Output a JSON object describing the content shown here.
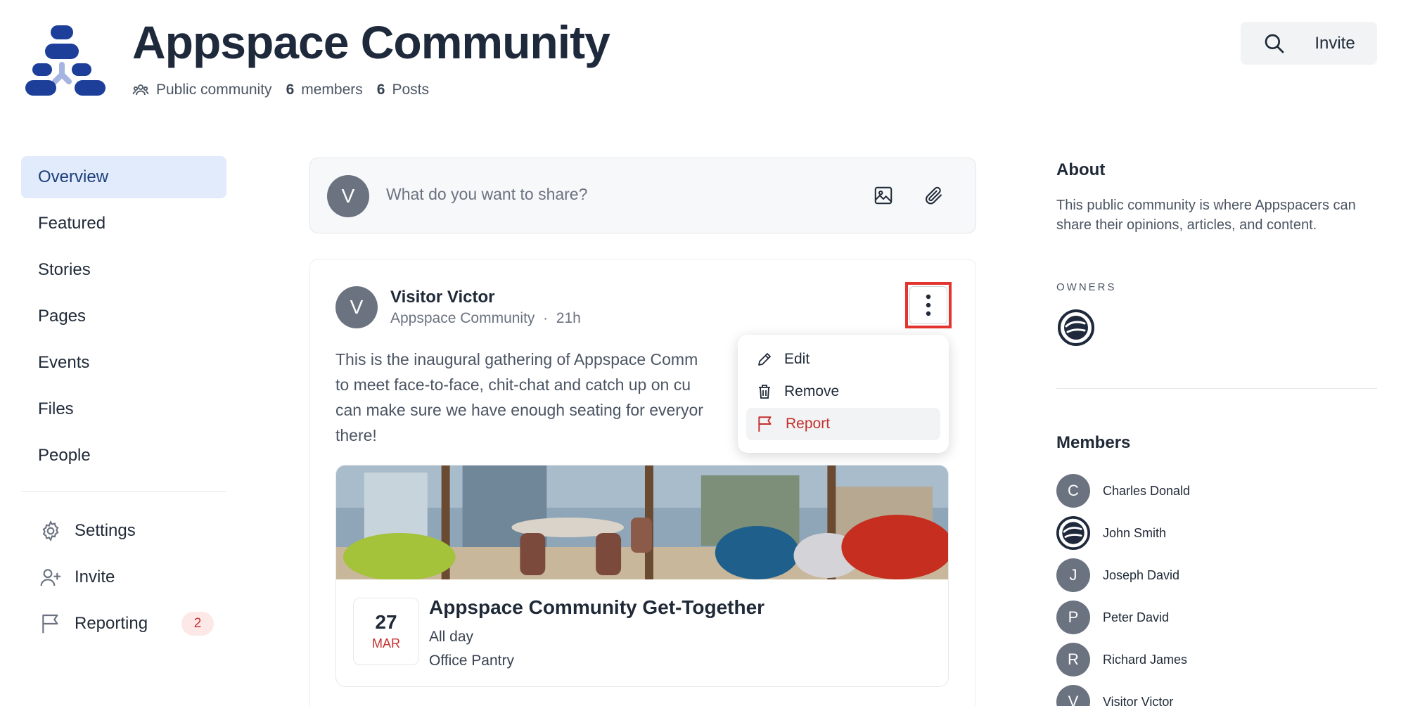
{
  "header": {
    "title": "Appspace Community",
    "community_type": "Public community",
    "members_count": "6",
    "members_label": "members",
    "posts_count": "6",
    "posts_label": "Posts",
    "invite_label": "Invite"
  },
  "nav": {
    "items": [
      {
        "label": "Overview"
      },
      {
        "label": "Featured"
      },
      {
        "label": "Stories"
      },
      {
        "label": "Pages"
      },
      {
        "label": "Events"
      },
      {
        "label": "Files"
      },
      {
        "label": "People"
      }
    ],
    "settings": "Settings",
    "invite": "Invite",
    "reporting": "Reporting",
    "reporting_count": "2"
  },
  "composer": {
    "avatar_letter": "V",
    "placeholder": "What do you want to share?"
  },
  "post": {
    "avatar_letter": "V",
    "author": "Visitor Victor",
    "community": "Appspace Community",
    "time": "21h",
    "body_line1": "This is the inaugural gathering of Appspace Comm",
    "body_line2": "to meet face-to-face, chit-chat and catch up on cu",
    "body_line3": "can make sure we have enough seating for everyor",
    "body_line4": "there!",
    "event": {
      "day": "27",
      "month": "MAR",
      "title": "Appspace Community Get-Together",
      "time": "All day",
      "location": "Office Pantry"
    }
  },
  "menu": {
    "edit": "Edit",
    "remove": "Remove",
    "report": "Report"
  },
  "about": {
    "heading": "About",
    "text": "This public community is where Appspacers can share their opinions, articles, and content.",
    "owners_heading": "OWNERS"
  },
  "members": {
    "heading": "Members",
    "list": [
      {
        "letter": "C",
        "name": "Charles Donald"
      },
      {
        "letter": "",
        "name": "John Smith"
      },
      {
        "letter": "J",
        "name": "Joseph David"
      },
      {
        "letter": "P",
        "name": "Peter David"
      },
      {
        "letter": "R",
        "name": "Richard James"
      },
      {
        "letter": "V",
        "name": "Visitor Victor"
      }
    ]
  },
  "colors": {
    "brand": "#1d3f9a",
    "active_nav_bg": "#e1ebfb",
    "danger": "#c53030",
    "highlight": "#e3342f"
  }
}
